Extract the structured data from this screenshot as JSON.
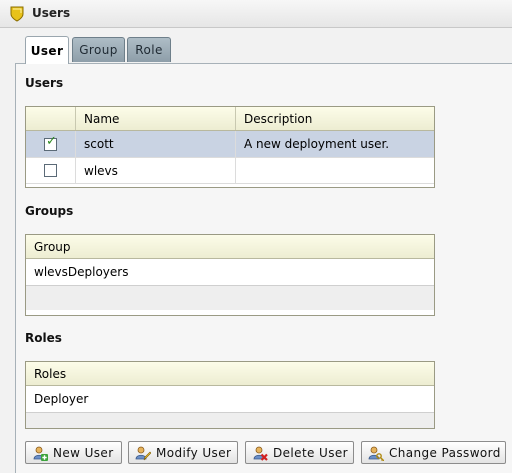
{
  "window": {
    "title": "Users",
    "icon": "shield-icon"
  },
  "tabs": [
    {
      "label": "User",
      "active": true
    },
    {
      "label": "Group",
      "active": false
    },
    {
      "label": "Role",
      "active": false
    }
  ],
  "users_section": {
    "title": "Users",
    "columns": [
      "",
      "Name",
      "Description"
    ],
    "rows": [
      {
        "checked": true,
        "name": "scott",
        "description": "A new deployment user.",
        "selected": true
      },
      {
        "checked": false,
        "name": "wlevs",
        "description": "",
        "selected": false
      }
    ]
  },
  "groups_section": {
    "title": "Groups",
    "column": "Group",
    "rows": [
      "wlevsDeployers"
    ]
  },
  "roles_section": {
    "title": "Roles",
    "column": "Roles",
    "rows": [
      "Deployer"
    ]
  },
  "buttons": {
    "new_user": {
      "label": "New User",
      "icon": "add-user-icon"
    },
    "modify_user": {
      "label": "Modify User",
      "icon": "edit-user-icon"
    },
    "delete_user": {
      "label": "Delete User",
      "icon": "delete-user-icon"
    },
    "change_password": {
      "label": "Change Password",
      "icon": "key-icon"
    }
  },
  "colors": {
    "selected_row": "#c9d3e3",
    "grid_header": "#f2f2dc",
    "tab_inactive": "#9eadb8"
  }
}
